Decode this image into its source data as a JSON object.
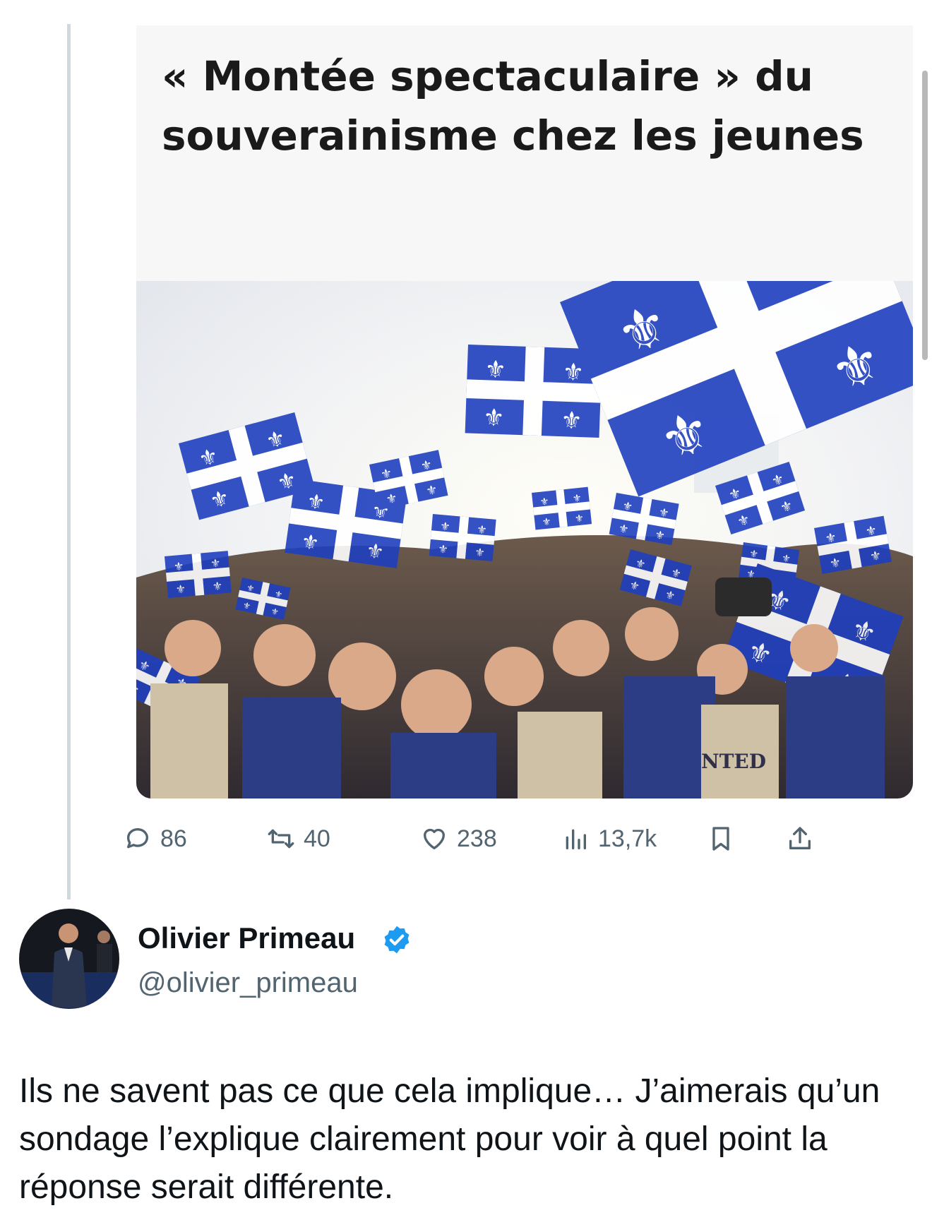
{
  "quoted_article": {
    "headline": "« Montée spectaculaire » du souverainisme chez les jeunes",
    "photo_subject": "crowd-waving-quebec-flags",
    "shirt_text": "NTED"
  },
  "actions": {
    "replies": "86",
    "reposts": "40",
    "likes": "238",
    "views": "13,7k"
  },
  "author": {
    "name": "Olivier Primeau",
    "handle": "@olivier_primeau",
    "verified": true
  },
  "tweet": {
    "text": "Ils ne savent pas ce que cela implique… J’aimerais qu’un sondage l’explique clairement pour voir à quel point la réponse serait différente."
  },
  "colors": {
    "flag_blue": "#1f3fbf",
    "verified_blue": "#1d9bf0",
    "muted_text": "#536471"
  }
}
